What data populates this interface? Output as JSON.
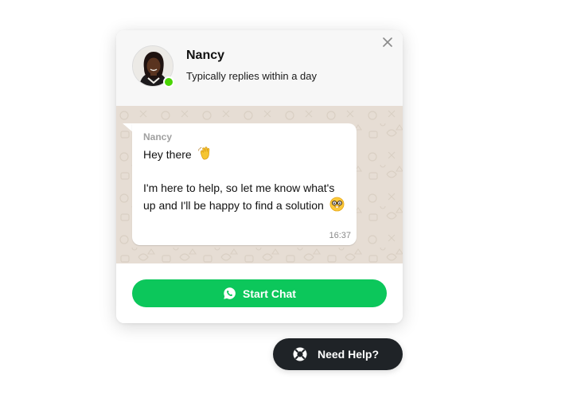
{
  "agent": {
    "name": "Nancy",
    "status": "Typically replies within a day",
    "online": true
  },
  "message": {
    "author": "Nancy",
    "line1": "Hey there",
    "line1_emoji": "waving-hand",
    "line2": "I'm here to help, so let me know what's up and I'll be happy to find a solution",
    "line2_emoji": "nerd-face",
    "time": "16:37"
  },
  "actions": {
    "start_chat_label": "Start Chat",
    "help_label": "Need Help?",
    "close_icon": "close-icon"
  },
  "colors": {
    "accent": "#0cc75b",
    "online": "#4ad504",
    "chat_background": "#e6ddd4",
    "help_button": "#1f2327"
  }
}
